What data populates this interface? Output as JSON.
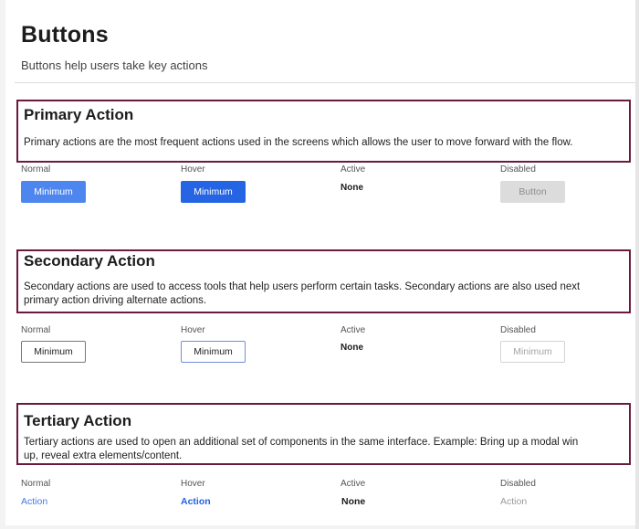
{
  "header": {
    "title": "Buttons",
    "subtitle": "Buttons help users take key actions"
  },
  "states": {
    "normal": "Normal",
    "hover": "Hover",
    "active": "Active",
    "disabled": "Disabled"
  },
  "primary": {
    "title": "Primary Action",
    "desc": "Primary actions are the most frequent actions used in the screens which allows the user to move forward with the flow.",
    "normal_label": "Minimum",
    "hover_label": "Minimum",
    "active_label": "None",
    "disabled_label": "Button",
    "colors": {
      "normal": "#4d86ee",
      "hover": "#2565e4",
      "disabled": "#dcdcdc"
    }
  },
  "secondary": {
    "title": "Secondary Action",
    "desc_line1": "Secondary actions are used to access tools that help users perform certain tasks. Secondary actions are also used next",
    "desc_line2": "primary action driving alternate actions.",
    "normal_label": "Minimum",
    "hover_label": "Minimum",
    "active_label": "None",
    "disabled_label": "Minimum"
  },
  "tertiary": {
    "title": "Tertiary Action",
    "desc_line1": "Tertiary actions are used to open an additional set of components in the same interface. Example: Bring up a modal win",
    "desc_line2": "up, reveal extra elements/content.",
    "normal_label": "Action",
    "hover_label": "Action",
    "active_label": "None",
    "disabled_label": "Action"
  },
  "highlight_color": "#6b1a3d"
}
